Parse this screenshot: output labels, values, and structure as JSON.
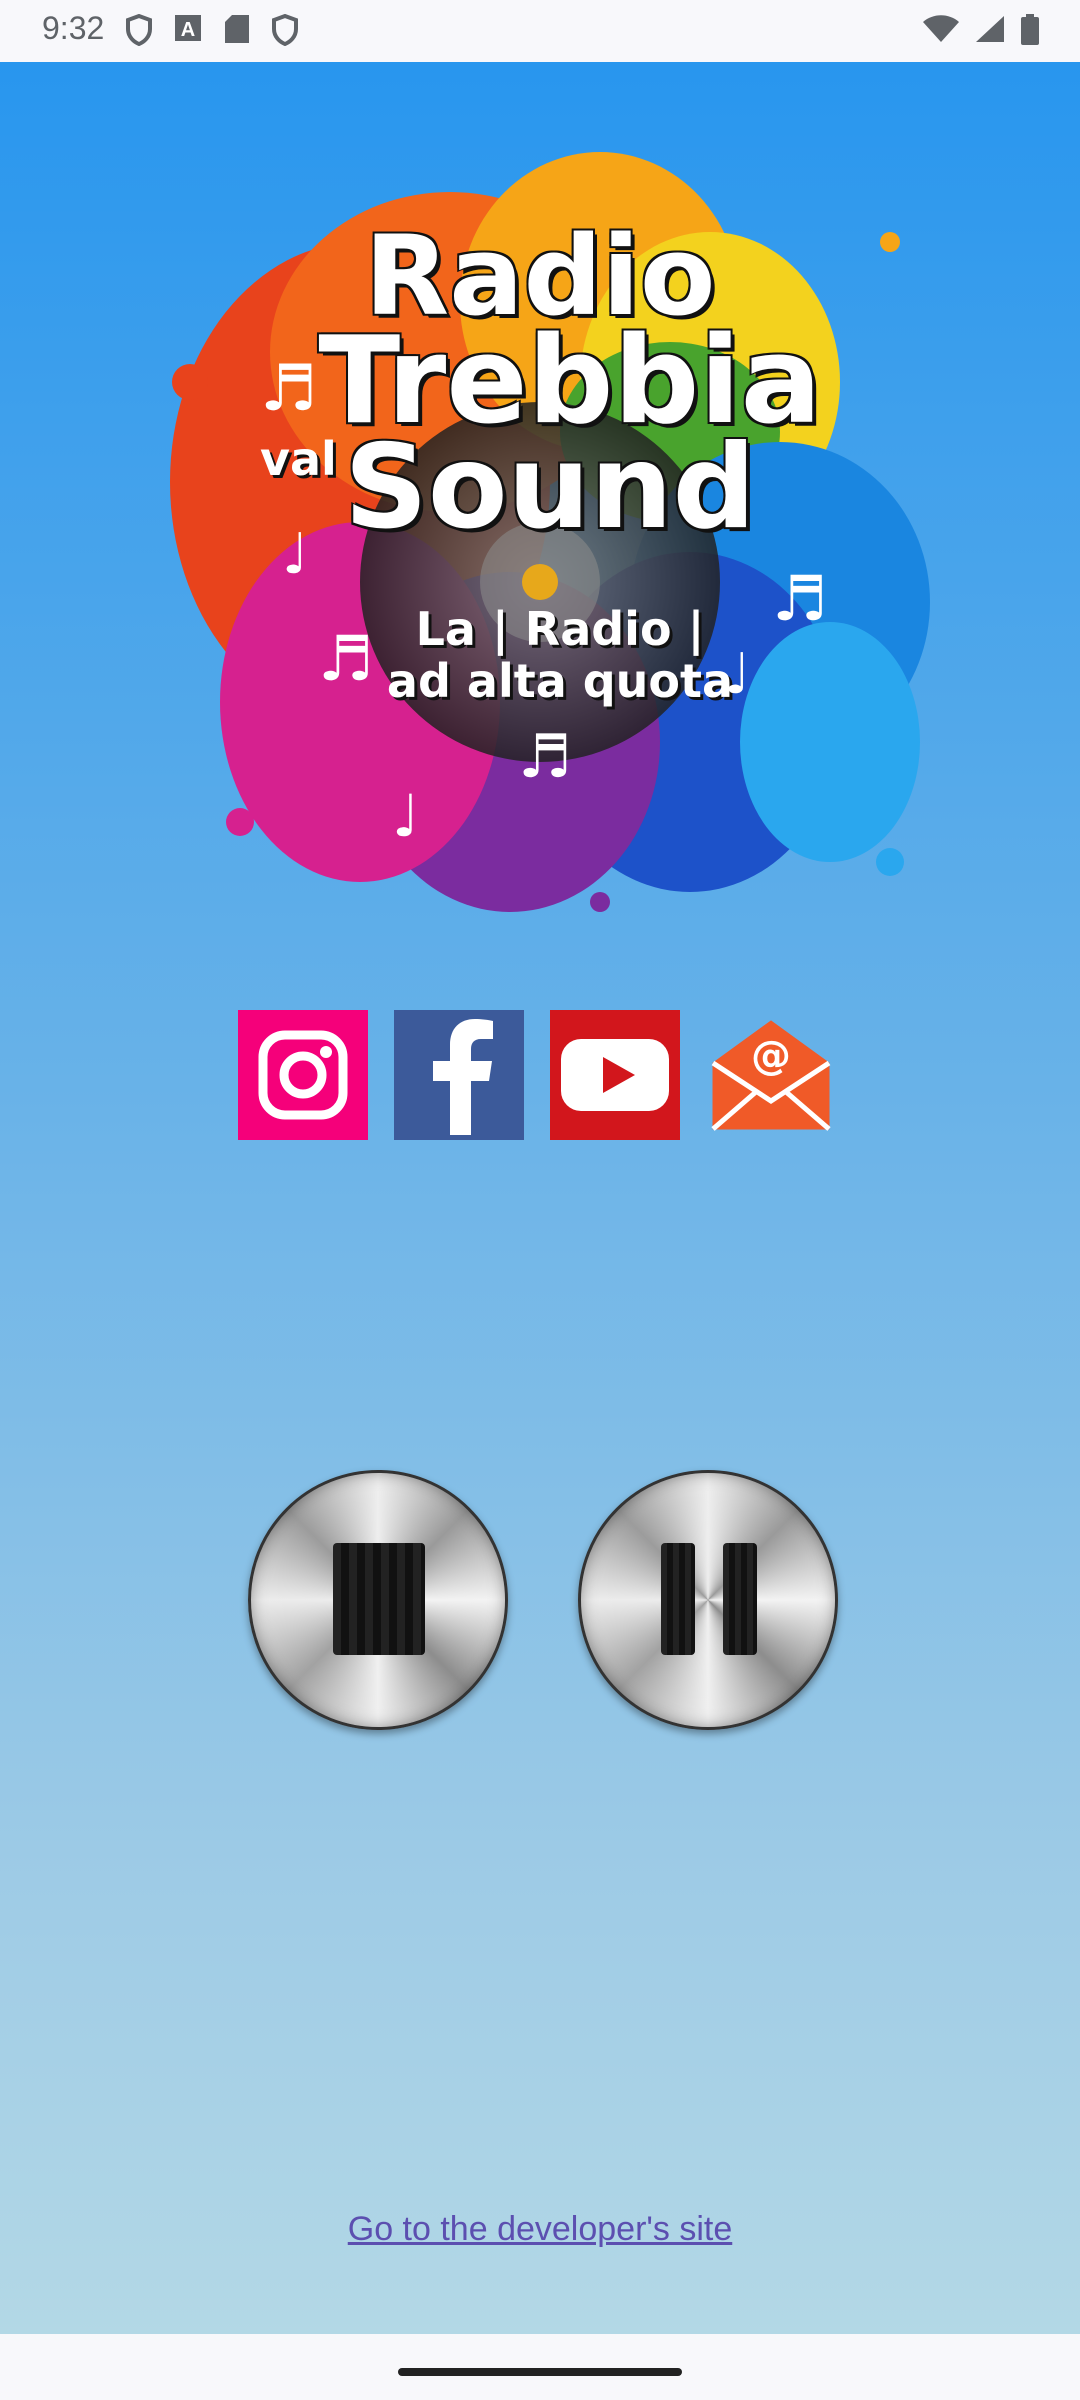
{
  "status_bar": {
    "time": "9:32",
    "left_icons": [
      "shield-icon",
      "a-badge-icon",
      "sd-card-icon",
      "shield-icon"
    ],
    "right_icons": [
      "wifi-icon",
      "cell-signal-icon",
      "battery-icon"
    ]
  },
  "logo": {
    "title_line1": "Radio",
    "title_line2": "Trebbia",
    "title_line3": "Sound",
    "prefix": "val",
    "tagline_line1": "La | Radio |",
    "tagline_line2": "ad alta quota"
  },
  "social": [
    {
      "name": "instagram",
      "color": "#f5007a"
    },
    {
      "name": "facebook",
      "color": "#3c5a9a"
    },
    {
      "name": "youtube",
      "color": "#d2161c"
    },
    {
      "name": "email",
      "color": "#f05a28"
    }
  ],
  "player": {
    "buttons": [
      "stop",
      "pause"
    ]
  },
  "footer": {
    "dev_link": "Go to the developer's site"
  },
  "colors": {
    "gradient_top": "#2896ee",
    "gradient_bottom": "#b3d8e6",
    "link": "#5c4fb0"
  }
}
